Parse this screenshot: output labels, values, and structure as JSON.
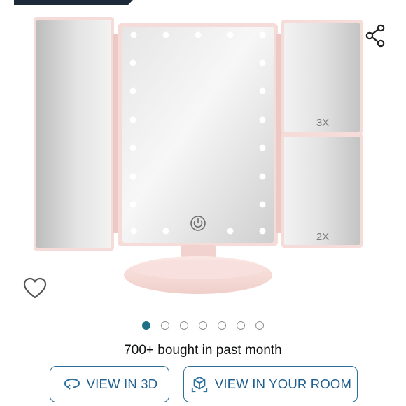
{
  "product": {
    "image_alt": "Tri-fold LED makeup vanity mirror",
    "magnification_top": "3X",
    "magnification_bottom": "2X"
  },
  "actions": {
    "share_icon": "share-icon",
    "wishlist_icon": "heart-icon"
  },
  "carousel": {
    "total": 7,
    "active_index": 0
  },
  "social_proof": {
    "bought_text": "700+ bought in past month"
  },
  "buttons": {
    "view_3d_label": "VIEW IN 3D",
    "view_room_label": "VIEW IN YOUR ROOM"
  },
  "colors": {
    "accent": "#1f6f86",
    "button_border": "#2b6f9a",
    "button_text": "#1f5f8f",
    "mirror_frame": "#f3d6d3"
  }
}
